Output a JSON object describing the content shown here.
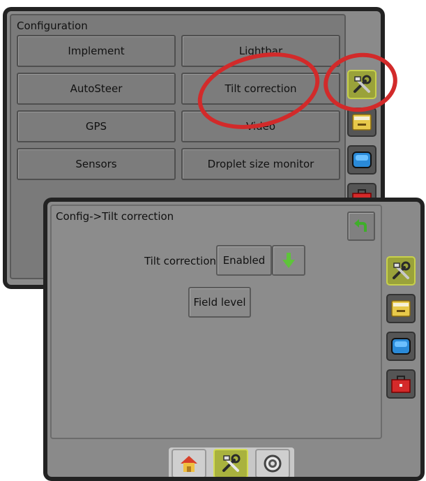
{
  "back_screen": {
    "title": "Configuration",
    "buttons": [
      {
        "label": "Implement"
      },
      {
        "label": "Lightbar"
      },
      {
        "label": "AutoSteer"
      },
      {
        "label": "Tilt correction"
      },
      {
        "label": "GPS"
      },
      {
        "label": "Video"
      },
      {
        "label": "Sensors"
      },
      {
        "label": "Droplet size monitor"
      }
    ],
    "side_tabs": [
      "tools-icon",
      "folder-icon",
      "display-icon",
      "toolbox-icon"
    ]
  },
  "front_screen": {
    "title": "Config->Tilt correction",
    "tilt_label": "Tilt correction",
    "tilt_value": "Enabled",
    "field_level_label": "Field level",
    "side_tabs": [
      "tools-icon",
      "folder-icon",
      "display-icon",
      "toolbox-icon"
    ],
    "bottom_nav": [
      "home-icon",
      "tools-icon",
      "gauge-icon"
    ]
  },
  "colors": {
    "highlight": "#d22a2a",
    "active_tab": "#9aa23a",
    "back_arrow": "#3fae2a"
  }
}
